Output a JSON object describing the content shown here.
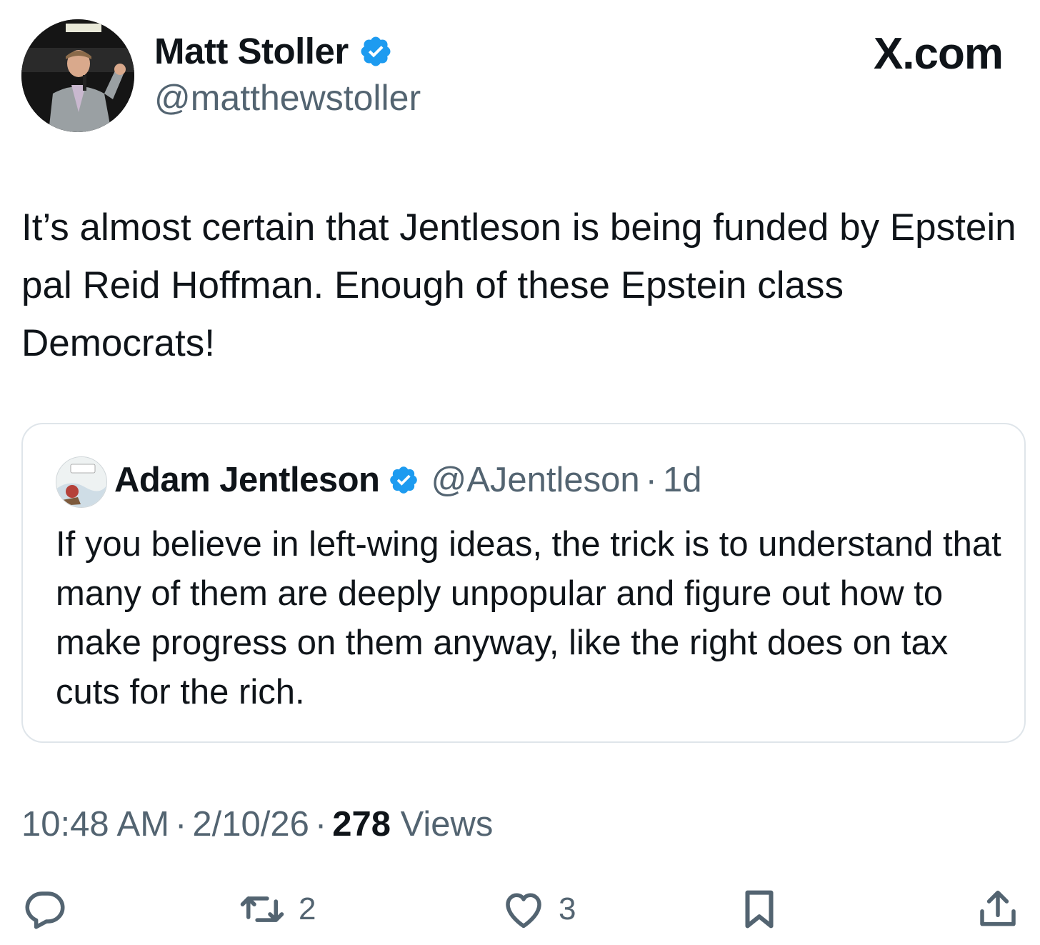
{
  "author": {
    "name": "Matt Stoller",
    "handle": "@matthewstoller"
  },
  "brand": "X.com",
  "tweet": {
    "text": "It’s almost certain that Jentleson is being funded by Epstein pal Reid Hoffman. Enough of these Epstein class Democrats!"
  },
  "quote": {
    "name": "Adam Jentleson",
    "handle": "@AJentleson",
    "separator": "·",
    "time": "1d",
    "text": "If you believe in left-wing ideas, the trick is to understand that many of them are deeply unpopular and figure out how to make progress on them anyway, like the right does on tax cuts for the rich."
  },
  "meta": {
    "time": "10:48 AM",
    "date": "2/10/26",
    "separator": "·",
    "views_count": "278",
    "views_label": "Views"
  },
  "actions": {
    "reply_icon": "reply-icon",
    "retweet_icon": "retweet-icon",
    "retweet_count": "2",
    "like_icon": "heart-icon",
    "like_count": "3",
    "bookmark_icon": "bookmark-icon",
    "share_icon": "share-icon"
  },
  "colors": {
    "verified": "#1d9bf0",
    "text": "#0f1419",
    "secondary": "#536471",
    "border": "#dfe5ea"
  }
}
